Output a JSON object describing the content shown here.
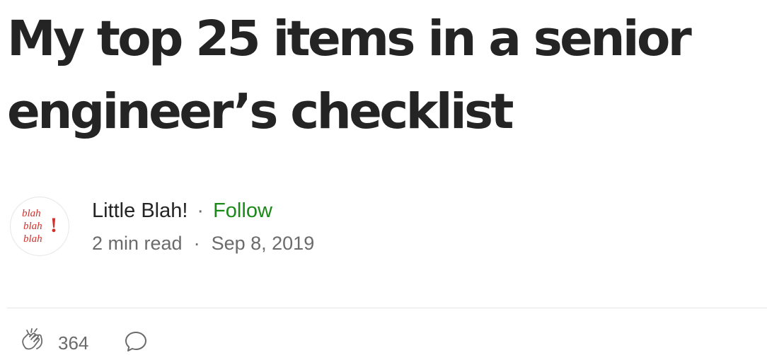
{
  "article": {
    "title": "My top 25 items in a senior engineer’s checklist"
  },
  "author": {
    "name": "Little Blah!",
    "follow_label": "Follow",
    "avatar_text": [
      "blah",
      "blah",
      "blah",
      "!"
    ],
    "separator": "·"
  },
  "meta": {
    "read_time": "2 min read",
    "date": "Sep 8, 2019"
  },
  "actions": {
    "clap_count": "364",
    "clap_icon": "clap-icon",
    "comment_icon": "comment-icon"
  },
  "colors": {
    "text": "#242424",
    "muted": "#6b6b6b",
    "follow": "#1a8917",
    "avatar_text": "#d1302b",
    "divider": "#e6e6e6"
  }
}
